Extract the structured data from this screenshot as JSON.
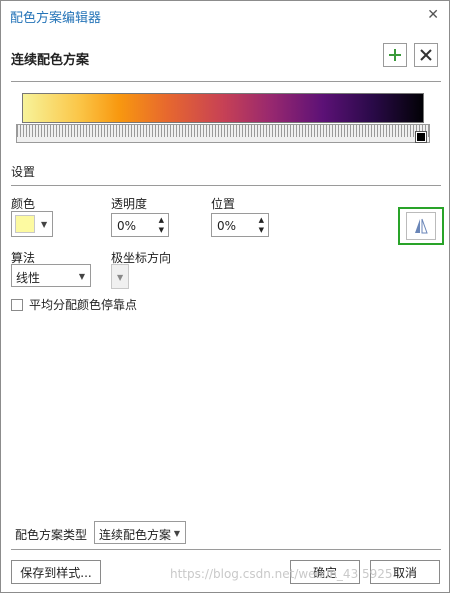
{
  "window": {
    "title": "配色方案编辑器",
    "close_glyph": "✕"
  },
  "scheme": {
    "title": "连续配色方案"
  },
  "settings": {
    "section_label": "设置",
    "color_label": "颜色",
    "color_value": "#fdfaa1",
    "transparency_label": "透明度",
    "transparency_value": "0%",
    "position_label": "位置",
    "position_value": "0%",
    "algorithm_label": "算法",
    "algorithm_value": "线性",
    "polar_label": "极坐标方向",
    "even_distribute_label": "平均分配颜色停靠点"
  },
  "footer": {
    "type_label": "配色方案类型",
    "type_value": "连续配色方案",
    "save_label": "保存到样式...",
    "ok_label": "确定",
    "cancel_label": "取消"
  },
  "watermark": "https://blog.csdn.net/weixin_43 5925",
  "icons": {
    "add": "plus-icon",
    "delete": "x-icon",
    "flip": "flip-icon"
  },
  "colors": {
    "accent_green": "#29a329",
    "title_blue": "#2574b8"
  }
}
